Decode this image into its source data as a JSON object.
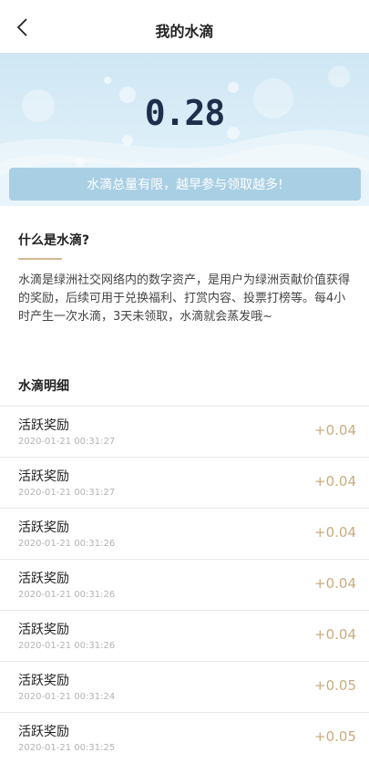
{
  "header": {
    "title": "我的水滴"
  },
  "balance": {
    "value": "0.28"
  },
  "banner": {
    "text": "水滴总量有限，越早参与领取越多!"
  },
  "about": {
    "title": "什么是水滴?",
    "description": "水滴是绿洲社交网络内的数字资产，是用户为绿洲贡献价值获得的奖励，后续可用于兑换福利、打赏内容、投票打榜等。每4小时产生一次水滴，3天未领取，水滴就会蒸发哦~"
  },
  "details": {
    "title": "水滴明细",
    "rows": [
      {
        "title": "活跃奖励",
        "time": "2020-01-21 00:31:27",
        "amount": "+0.04"
      },
      {
        "title": "活跃奖励",
        "time": "2020-01-21 00:31:27",
        "amount": "+0.04"
      },
      {
        "title": "活跃奖励",
        "time": "2020-01-21 00:31:26",
        "amount": "+0.04"
      },
      {
        "title": "活跃奖励",
        "time": "2020-01-21 00:31:26",
        "amount": "+0.04"
      },
      {
        "title": "活跃奖励",
        "time": "2020-01-21 00:31:26",
        "amount": "+0.04"
      },
      {
        "title": "活跃奖励",
        "time": "2020-01-21 00:31:24",
        "amount": "+0.05"
      },
      {
        "title": "活跃奖励",
        "time": "2020-01-21 00:31:25",
        "amount": "+0.05"
      }
    ]
  },
  "colors": {
    "accent": "#c9ac7d",
    "banner": "#a9cfe4",
    "balance": "#1d2f4c"
  }
}
